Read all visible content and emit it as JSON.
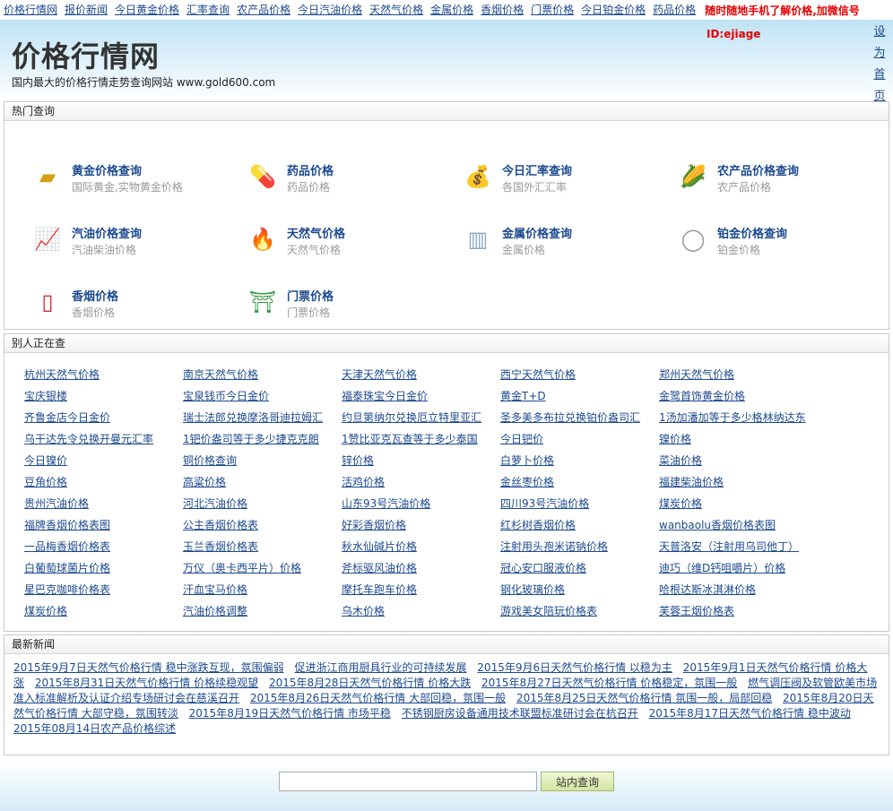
{
  "topnav": {
    "links": [
      "价格行情网",
      "报价新闻",
      "今日黄金价格",
      "汇率查询",
      "农产品价格",
      "今日汽油价格",
      "天然气价格",
      "金属价格",
      "香烟价格",
      "门票价格",
      "今日铂金价格",
      "药品价格"
    ],
    "promo": "随时随地手机了解价格,加微信号"
  },
  "header": {
    "title": "价格行情网",
    "tagline": "国内最大的价格行情走势查询网站 www.gold600.com",
    "id_label": "ID:ejiage",
    "side_link": "设为首页"
  },
  "hot": {
    "title": "热门查询",
    "items": [
      {
        "name": "黄金价格查询",
        "desc": "国际黄金,实物黄金价格",
        "icon": "gold-bar-icon"
      },
      {
        "name": "药品价格",
        "desc": "药品价格",
        "icon": "pill-icon"
      },
      {
        "name": "今日汇率查询",
        "desc": "各国外汇汇率",
        "icon": "money-bag-icon"
      },
      {
        "name": "农产品价格查询",
        "desc": "农产品价格",
        "icon": "corn-icon"
      },
      {
        "name": "汽油价格查询",
        "desc": "汽油柴油价格",
        "icon": "oil-chart-icon"
      },
      {
        "name": "天然气价格",
        "desc": "天然气价格",
        "icon": "gas-flame-icon"
      },
      {
        "name": "金属价格查询",
        "desc": "金属价格",
        "icon": "metal-pipes-icon"
      },
      {
        "name": "铂金价格查询",
        "desc": "铂金价格",
        "icon": "platinum-ring-icon"
      },
      {
        "name": "香烟价格",
        "desc": "香烟价格",
        "icon": "cigarette-pack-icon"
      },
      {
        "name": "门票价格",
        "desc": "门票价格",
        "icon": "temple-icon"
      }
    ]
  },
  "others": {
    "title": "别人正在查",
    "links": [
      "杭州天然气价格",
      "南京天然气价格",
      "天津天然气价格",
      "西宁天然气价格",
      "郑州天然气价格",
      "宝庆银楼",
      "宝泉钱币今日金价",
      "福泰珠宝今日金价",
      "黄金T+D",
      "金鹭首饰黄金价格",
      "齐鲁金店今日金价",
      "瑞士法郎兑换摩洛哥迪拉姆汇",
      "约旦第纳尔兑换厄立特里亚汇",
      "圣多美多布拉兑换铂价盎司汇",
      "1汤加潘加等于多少格林纳达东",
      "乌干达先令兑换开曼元汇率",
      "1钯价盎司等于多少捷克克朗",
      "1赞比亚克瓦查等于多少泰国",
      "今日钯价",
      "镍价格",
      "今日镍价",
      "铜价格查询",
      "锌价格",
      "白萝卜价格",
      "菜油价格",
      "豆角价格",
      "高粱价格",
      "活鸡价格",
      "金丝枣价格",
      "福建柴油价格",
      "贵州汽油价格",
      "河北汽油价格",
      "山东93号汽油价格",
      "四川93号汽油价格",
      "煤炭价格",
      "福牌香烟价格表图",
      "公主香烟价格表",
      "好彩香烟价格",
      "红杉树香烟价格",
      "wanbaolu香烟价格表图",
      "一品梅香烟价格表",
      "玉兰香烟价格表",
      "秋水仙碱片价格",
      "注射用头孢米诺钠价格",
      "天普洛安（注射用乌司他丁）",
      "白葡萄球菌片价格",
      "万仪（奥卡西平片）价格",
      "斧标驱风油价格",
      "冠心安口服液价格",
      "迪巧（维D钙咀嚼片）价格",
      "星巴克咖啡价格表",
      "汗血宝马价格",
      "摩托车跑车价格",
      "钢化玻璃价格",
      "哈根达斯冰淇淋价格",
      "煤炭价格",
      "汽油价格调整",
      "乌木价格",
      "游戏美女陪玩价格表",
      "芙蓉王烟价格表"
    ]
  },
  "news": {
    "title": "最新新闻",
    "items": [
      "2015年9月7日天然气价格行情 稳中涨跌互现，氛围偏弱",
      "促进浙江商用厨具行业的可持续发展",
      "2015年9月6日天然气价格行情 以稳为主",
      "2015年9月1日天然气价格行情 价格大涨",
      "2015年8月31日天然气价格行情 价格续稳观望",
      "2015年8月28日天然气价格行情 价格大跌",
      "2015年8月27日天然气价格行情 价格稳定，氛围一般",
      "燃气调压阀及软管欧美市场准入标准解析及认证介绍专场研讨会在慈溪召开",
      "2015年8月26日天然气价格行情 大部回稳，氛围一般",
      "2015年8月25日天然气价格行情 氛围一般，局部回稳",
      "2015年8月20日天然气价格行情 大部守稳，氛围转淡",
      "2015年8月19日天然气价格行情 市场平稳",
      "不锈钢厨房设备通用技术联盟标准研讨会在杭召开",
      "2015年8月17日天然气价格行情 稳中波动",
      "2015年08月14日农产品价格综述"
    ]
  },
  "footer": {
    "search_placeholder": "",
    "search_button": "站内查询"
  }
}
